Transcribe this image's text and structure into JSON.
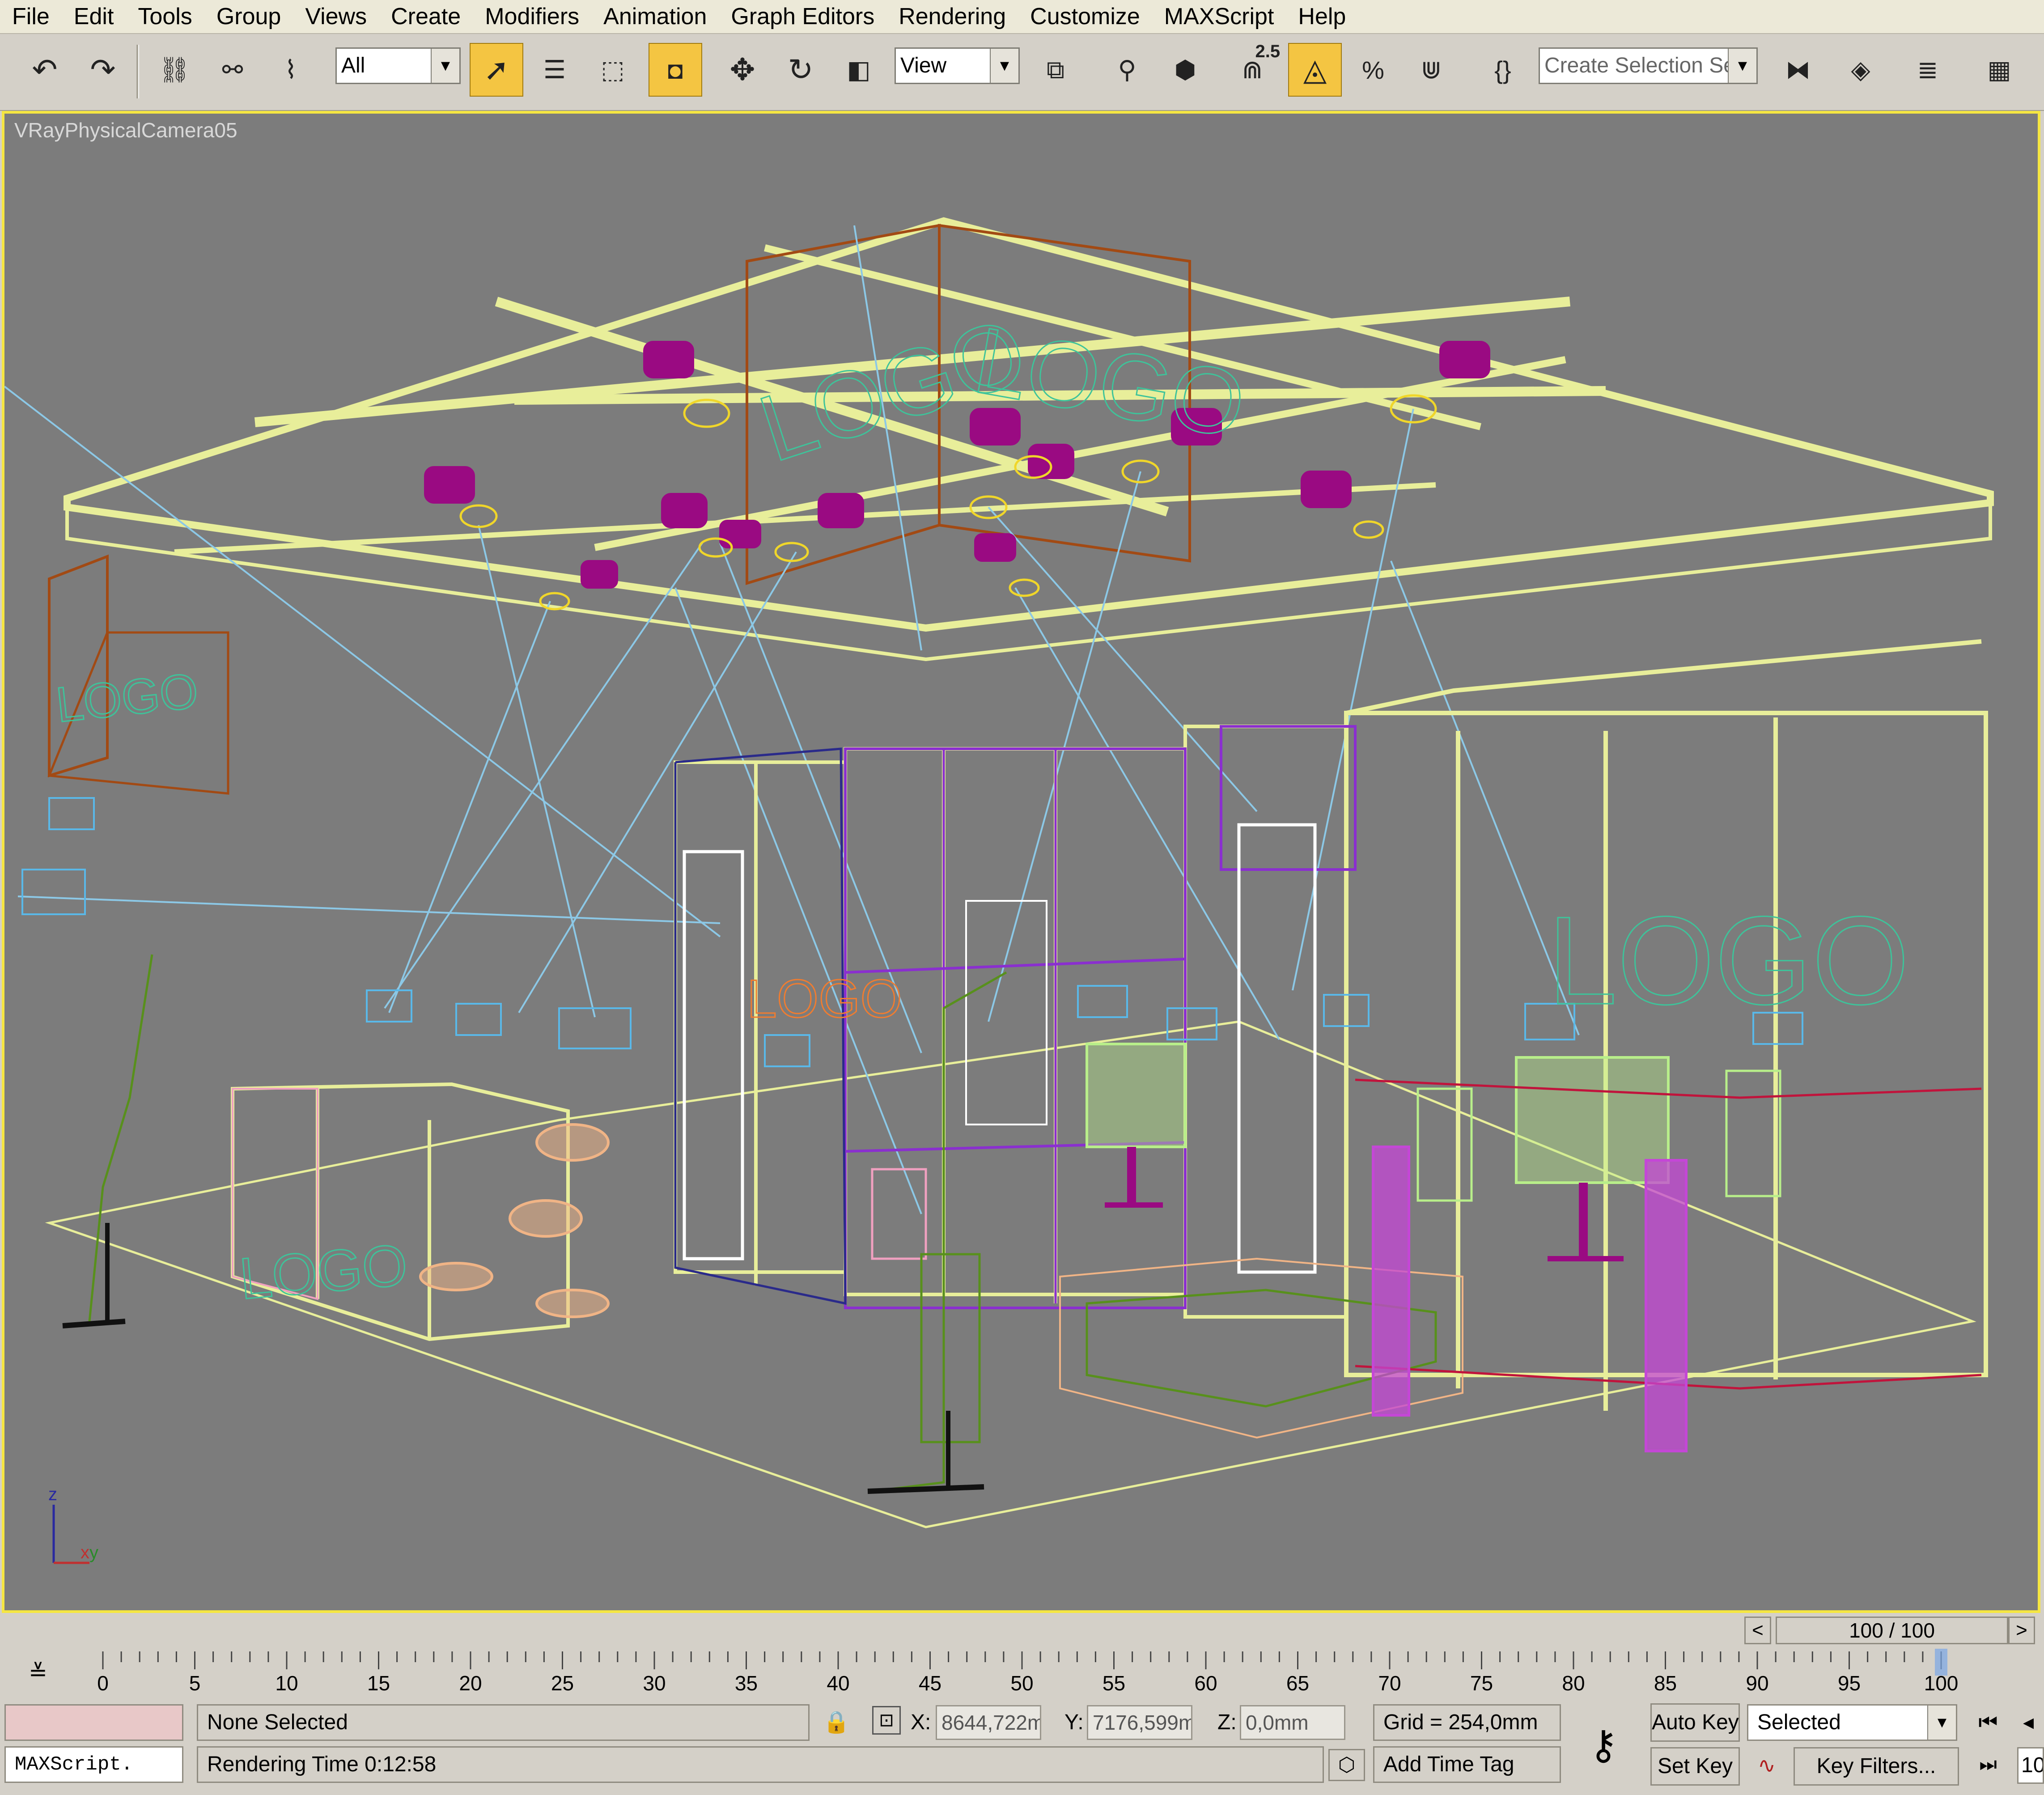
{
  "menu": [
    "File",
    "Edit",
    "Tools",
    "Group",
    "Views",
    "Create",
    "Modifiers",
    "Animation",
    "Graph Editors",
    "Rendering",
    "Customize",
    "MAXScript",
    "Help"
  ],
  "toolbar": {
    "filter_value": "All",
    "refcoord_value": "View",
    "snap_angle_value": "2.5",
    "selection_set_placeholder": "Create Selection Set"
  },
  "viewport": {
    "label": "VRayPhysicalCamera05",
    "scene_logo": "LOGO",
    "axis_z": "z",
    "axis_x": "x",
    "axis_y": "y",
    "colors": {
      "frame": "#e8ee9a",
      "light": "#9a0a82",
      "target": "#f0d62a",
      "line": "#8cc8e6",
      "wall": "#a24a14",
      "door": "#ffffff",
      "purple": "#8a2fcf",
      "logo": "#3ec39a",
      "furniture": "#b8ee8a",
      "vase": "#c447d6",
      "box": "#f0b486",
      "green": "#58901c",
      "pink": "#f0a0c0"
    }
  },
  "timeslider": {
    "frame_display": "100 / 100",
    "prev": "<",
    "next": ">"
  },
  "track": {
    "ticks": [
      "0",
      "5",
      "10",
      "15",
      "20",
      "25",
      "30",
      "35",
      "40",
      "45",
      "50",
      "55",
      "60",
      "65",
      "70",
      "75",
      "80",
      "85",
      "90",
      "95",
      "100"
    ],
    "current_frame": 100
  },
  "status": {
    "maxscript_label": "MAXScript.",
    "selection_status": "None Selected",
    "rendering_time": "Rendering Time  0:12:58",
    "x_label": "X:",
    "x_value": "8644,722m",
    "y_label": "Y:",
    "y_value": "7176,599m",
    "z_label": "Z:",
    "z_value": "0,0mm",
    "grid": "Grid = 254,0mm",
    "add_time_tag": "Add Time Tag",
    "auto_key": "Auto Key",
    "set_key": "Set Key",
    "key_mode": "Selected",
    "key_filters": "Key Filters...",
    "frame_field": "10"
  }
}
